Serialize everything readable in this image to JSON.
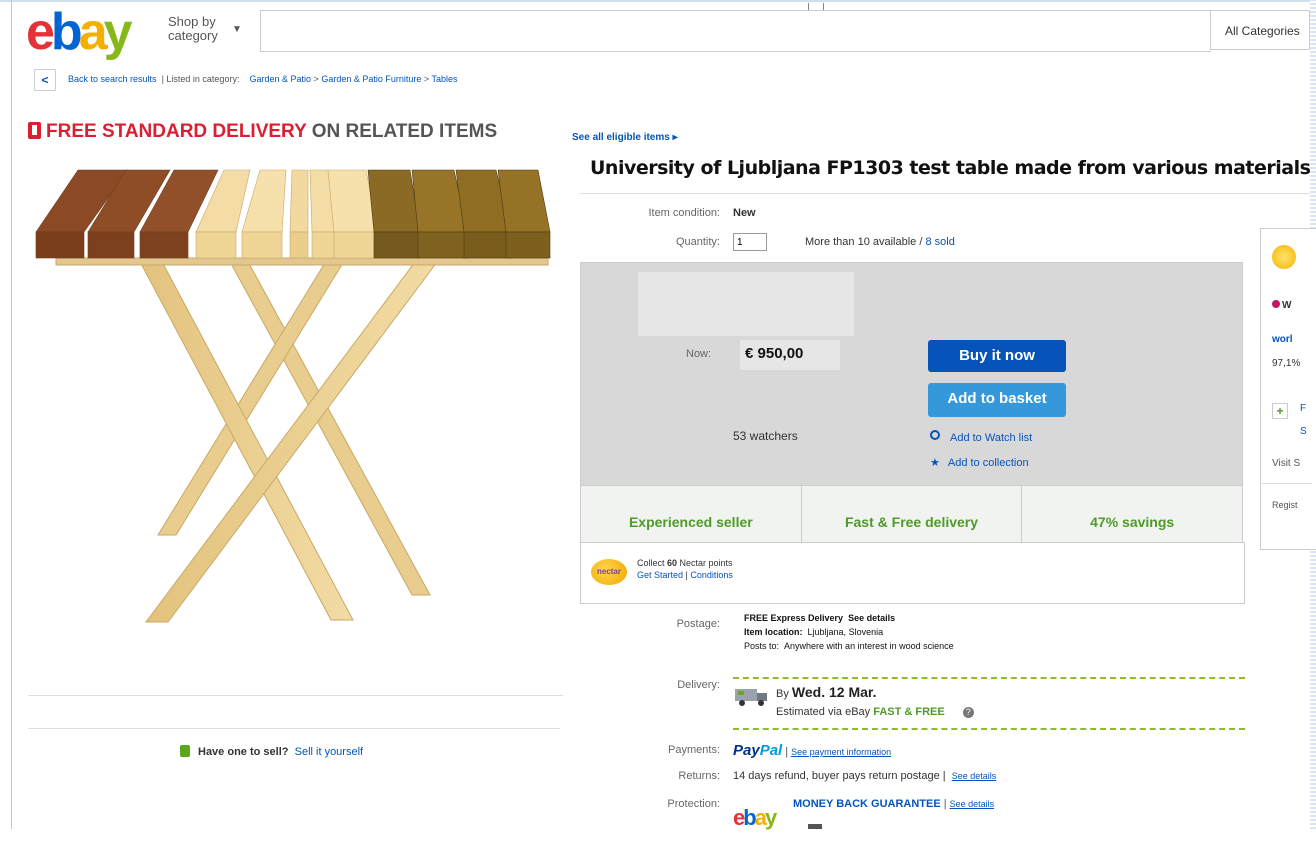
{
  "header": {
    "logo": {
      "e": "e",
      "b": "b",
      "a": "a",
      "y": "y"
    },
    "shop_by": "Shop by",
    "category": "category",
    "all_categories": "All Categories"
  },
  "breadcrumb": {
    "back": "Back to search results",
    "listed": "| Listed in category:",
    "items": [
      "Garden & Patio",
      "Garden & Patio Furniture",
      "Tables"
    ],
    "separator": ">"
  },
  "banner": {
    "free": "FREE STANDARD DELIVERY",
    "rest": "ON RELATED ITEMS",
    "see_all": "See all eligible items ▸"
  },
  "listing": {
    "title": "University of Ljubljana FP1303 test table made from various materials",
    "condition_label": "Item condition:",
    "condition": "New",
    "quantity_label": "Quantity:",
    "quantity": "1",
    "available": "More than 10 available / ",
    "sold": "8 sold",
    "now_label": "Now:",
    "price": "€ 950,00",
    "buy_now": "Buy it now",
    "add_basket": "Add to basket",
    "watchers": "53 watchers",
    "watch_list": "Add to Watch list",
    "collection": "Add to collection",
    "features": [
      "Experienced seller",
      "Fast & Free delivery",
      "47% savings"
    ]
  },
  "nectar": {
    "logo": "nectar",
    "collect": "Collect ",
    "points": "60",
    "points_suffix": " Nectar points",
    "get_started": "Get Started",
    "sep": " | ",
    "conditions": "Conditions"
  },
  "postage": {
    "label": "Postage:",
    "line1_bold": "FREE Express Delivery",
    "line1_link": "See details",
    "line2_label": "Item location:",
    "line2": "Ljubljana, Slovenia",
    "line3_label": "Posts to:",
    "line3": "Anywhere with an interest in wood science"
  },
  "delivery": {
    "label": "Delivery:",
    "by": "By ",
    "date": "Wed. 12 Mar.",
    "est": "Estimated via eBay ",
    "fast": "FAST & FREE",
    "info": "?"
  },
  "payments": {
    "label": "Payments:",
    "pay": "Pay",
    "pal": "Pal",
    "sep": "|",
    "link": "See payment information"
  },
  "returns": {
    "label": "Returns:",
    "text": "14 days refund, buyer pays return postage",
    "sep": "|",
    "link": "See details"
  },
  "protection": {
    "label": "Protection:",
    "guarantee": "MONEY BACK GUARANTEE",
    "sep": "|",
    "link": "See details"
  },
  "sell": {
    "question": "Have one to sell?",
    "link": "Sell it yourself"
  },
  "seller_panel": {
    "name": "W",
    "world": "worl",
    "percent": "97,1%",
    "f": "F",
    "s": "S",
    "visit": "Visit S",
    "regist": "Regist"
  }
}
